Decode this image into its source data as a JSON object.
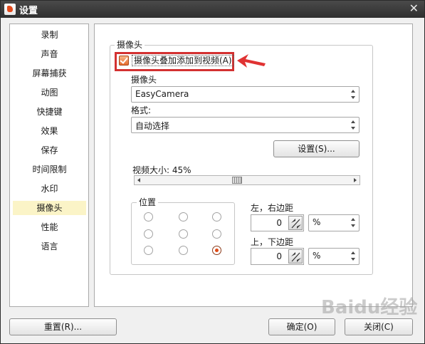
{
  "window": {
    "title": "设置",
    "close_glyph": "✕",
    "app_icon": "app-logo-icon"
  },
  "sidebar": {
    "items": [
      {
        "label": "录制"
      },
      {
        "label": "声音"
      },
      {
        "label": "屏幕捕获"
      },
      {
        "label": "动图"
      },
      {
        "label": "快捷键"
      },
      {
        "label": "效果"
      },
      {
        "label": "保存"
      },
      {
        "label": "时间限制"
      },
      {
        "label": "水印"
      },
      {
        "label": "摄像头"
      },
      {
        "label": "性能"
      },
      {
        "label": "语言"
      }
    ],
    "active": "摄像头",
    "active_color": "#fbf4c7"
  },
  "camera": {
    "group_title": "摄像头",
    "overlay_checkbox_label": "摄像头叠加添加到视频(A)",
    "overlay_checked": true,
    "highlight_color": "#d33131",
    "device_label": "摄像头",
    "device_value": "EasyCamera",
    "format_label": "格式:",
    "format_value": "自动选择",
    "settings_button": "设置(S)...",
    "size_label": "视频大小: 45%",
    "size_percent": 45,
    "position_group_title": "位置",
    "position_selected": "bottom-right",
    "lr_margin_label": "左，右边距",
    "lr_margin_value": "0",
    "lr_margin_unit": "%",
    "tb_margin_label": "上，下边距",
    "tb_margin_value": "0",
    "tb_margin_unit": "%"
  },
  "footer": {
    "reset_button": "重置(R)...",
    "ok_button": "确定(O)",
    "close_button": "关闭(C)"
  },
  "watermark_text": "Baidu经验"
}
